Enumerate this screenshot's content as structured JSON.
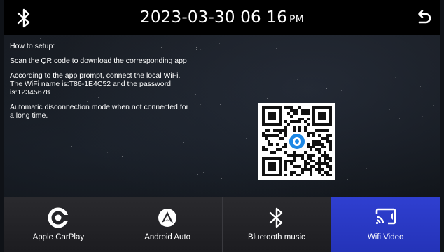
{
  "header": {
    "datetime": "2023-03-30 06 16",
    "ampm": "PM",
    "bluetooth_icon": "bluetooth-icon",
    "back_icon": "back-icon"
  },
  "instructions": {
    "title": "How to setup:",
    "step1": "Scan the QR code to download the corresponding app",
    "step2": "According to the app prompt, connect the local WiFi. The WiFi name is:T86-1E4C52 and the password is:12345678",
    "step3": "Automatic disconnection mode when not connected for a long time."
  },
  "qr": {
    "icon": "qr-code-icon"
  },
  "tabs": [
    {
      "label": "Apple CarPlay",
      "icon": "carplay-icon",
      "active": false
    },
    {
      "label": "Android Auto",
      "icon": "android-auto-icon",
      "active": false
    },
    {
      "label": "Bluetooth music",
      "icon": "bluetooth-icon",
      "active": false
    },
    {
      "label": "Wifi Video",
      "icon": "screen-cast-icon",
      "active": true
    }
  ],
  "colors": {
    "active_tab": "#2a3ac6",
    "topbar": "#000000",
    "qr_center": "#1e88e5"
  }
}
